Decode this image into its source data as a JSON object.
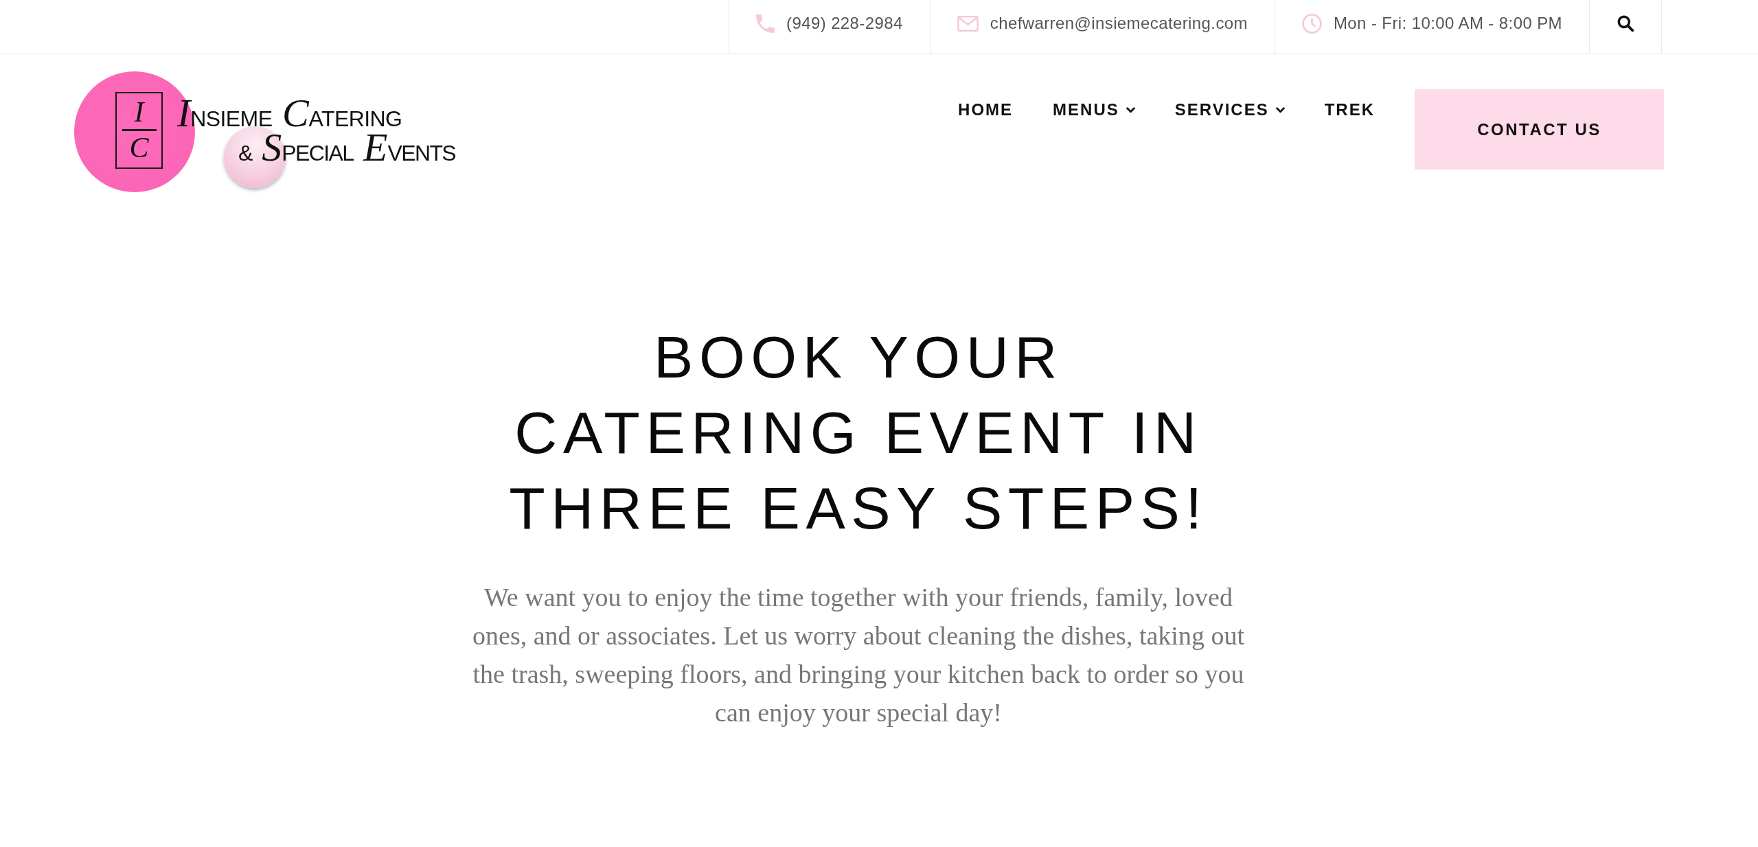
{
  "top_bar": {
    "contacts": [
      {
        "kind": "phone",
        "text": "(949) 228-2984"
      },
      {
        "kind": "email",
        "text": "chefwarren@insiemecatering.com"
      },
      {
        "kind": "hours",
        "text": "Mon - Fri: 10:00 AM - 8:00 PM"
      }
    ]
  },
  "logo": {
    "monogram_top": "I",
    "monogram_bottom": "C",
    "name": "INSIEME CATERING",
    "tagline": "& SPECIAL EVENTS"
  },
  "nav": {
    "items": [
      {
        "label": "HOME",
        "has_dropdown": false
      },
      {
        "label": "MENUS",
        "has_dropdown": true
      },
      {
        "label": "SERVICES",
        "has_dropdown": true
      },
      {
        "label": "TREK",
        "has_dropdown": false
      }
    ],
    "cta": "CONTACT US"
  },
  "hero": {
    "heading": "BOOK YOUR CATERING EVENT IN THREE EASY STEPS!",
    "body": "We want you to enjoy the time together with your friends, family, loved ones, and or associates. Let us worry about cleaning the dishes, taking out the trash, sweeping floors, and bringing your kitchen back to order so you can enjoy your special day!"
  }
}
